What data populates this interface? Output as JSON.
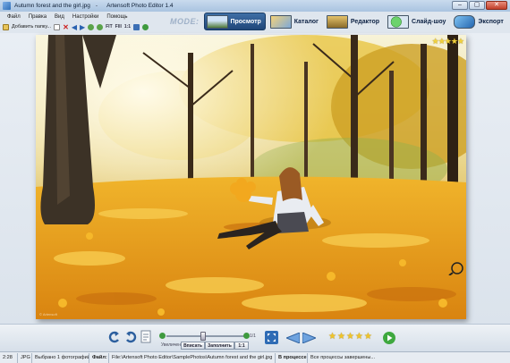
{
  "window": {
    "title": "Autumn forest and the girl.jpg",
    "app_name": "Artensoft Photo Editor 1.4",
    "minimize_glyph": "–",
    "maximize_glyph": "▢",
    "close_glyph": "✕"
  },
  "menu": [
    "Файл",
    "Правка",
    "Вид",
    "Настройки",
    "Помощь"
  ],
  "toolbar": {
    "add_folder_label": "Добавить папку...",
    "fit_label": "FIT",
    "fill_label": "FIll",
    "one_to_one_label": "1:1"
  },
  "modes": {
    "label": "MODE:",
    "tabs": [
      {
        "name": "Просмотр",
        "active": true
      },
      {
        "name": "Каталог",
        "active": false
      },
      {
        "name": "Редактор",
        "active": false
      },
      {
        "name": "Слайд-шоу",
        "active": false
      },
      {
        "name": "Экспорт",
        "active": false
      }
    ]
  },
  "photo": {
    "subject": "girl sitting on autumn leaves in a forest",
    "rating_stars": 5
  },
  "bottom_panel": {
    "zoom_min_label": "1/8",
    "zoom_max_label": "1/1",
    "zoom_caption": "Увеличение",
    "fit_button": "Вписать",
    "fill_button": "Заполнить",
    "one_button": "1:1",
    "rating": 5
  },
  "status": {
    "resolution": "2:28",
    "format": "JPG",
    "selected": "Выбрано 1 фотографий",
    "file_label": "Файл:",
    "file_path": "File:\\Artensoft Photo Editor\\SamplePhotos\\Autumn forest and the girl.jpg",
    "process_label": "В процессе:",
    "process_status": "Все процессы завершены..."
  },
  "colors": {
    "accent": "#1f4679",
    "leaves": "#e8a21c",
    "star": "#f0c428"
  }
}
